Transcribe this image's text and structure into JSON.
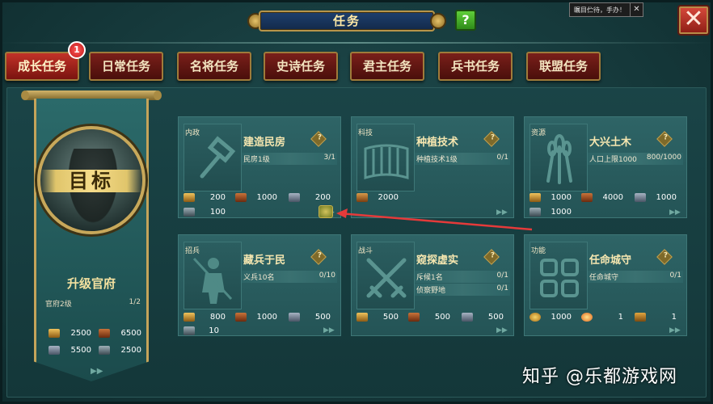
{
  "title": "任务",
  "help_label": "?",
  "tooltip": {
    "text": "瞩目伫待，手办！",
    "close": "✕"
  },
  "close_label": "✕",
  "tabs": [
    {
      "label": "成长任务",
      "active": true,
      "badge": "1"
    },
    {
      "label": "日常任务"
    },
    {
      "label": "名将任务"
    },
    {
      "label": "史诗任务"
    },
    {
      "label": "君主任务"
    },
    {
      "label": "兵书任务"
    },
    {
      "label": "联盟任务"
    }
  ],
  "banner": {
    "target": "目标",
    "title": "升级官府",
    "requirement": "官府2级",
    "progress": "1/2",
    "costs": [
      {
        "icon": "copper-icon",
        "value": "2500"
      },
      {
        "icon": "wood-icon",
        "value": "6500"
      },
      {
        "icon": "iron-icon",
        "value": "5500"
      },
      {
        "icon": "troop-icon",
        "value": "2500"
      }
    ],
    "arrow": "▶▶"
  },
  "cards": [
    {
      "type": "内政",
      "name": "建造民房",
      "icon": "hammer-icon",
      "qmark": "?",
      "reqs": [
        {
          "text": "民房1级",
          "progress": "3/1"
        }
      ],
      "costs": [
        {
          "icon": "copper-icon",
          "value": "200"
        },
        {
          "icon": "wood-icon",
          "value": "1000"
        },
        {
          "icon": "iron-icon",
          "value": "200"
        },
        {
          "icon": "troop-icon",
          "value": "100"
        }
      ],
      "arrow": "▶▶"
    },
    {
      "type": "科技",
      "name": "种植技术",
      "icon": "scroll-icon",
      "qmark": "?",
      "reqs": [
        {
          "text": "种植技术1级",
          "progress": "0/1"
        }
      ],
      "costs": [
        {
          "icon": "food-icon",
          "value": "2000"
        }
      ],
      "arrow": "▶▶"
    },
    {
      "type": "资源",
      "name": "大兴土木",
      "icon": "wheat-icon",
      "qmark": "?",
      "reqs": [
        {
          "text": "人口上限1000",
          "progress": "800/1000"
        }
      ],
      "costs": [
        {
          "icon": "copper-icon",
          "value": "1000"
        },
        {
          "icon": "wood-icon",
          "value": "4000"
        },
        {
          "icon": "iron-icon",
          "value": "1000"
        },
        {
          "icon": "troop-icon",
          "value": "1000"
        }
      ],
      "arrow": "▶▶"
    },
    {
      "type": "招兵",
      "name": "藏兵于民",
      "icon": "soldier-icon",
      "qmark": "?",
      "reqs": [
        {
          "text": "义兵10名",
          "progress": "0/10"
        }
      ],
      "costs": [
        {
          "icon": "copper-icon",
          "value": "800"
        },
        {
          "icon": "wood-icon",
          "value": "1000"
        },
        {
          "icon": "iron-icon",
          "value": "500"
        },
        {
          "icon": "troop-icon",
          "value": "10"
        }
      ],
      "arrow": "▶▶"
    },
    {
      "type": "战斗",
      "name": "窥探虚实",
      "icon": "crossed-swords-icon",
      "qmark": "?",
      "reqs": [
        {
          "text": "斥候1名",
          "progress": "0/1"
        },
        {
          "text": "侦察野地",
          "progress": "0/1"
        }
      ],
      "costs": [
        {
          "icon": "copper-icon",
          "value": "500"
        },
        {
          "icon": "wood-icon",
          "value": "500"
        },
        {
          "icon": "iron-icon",
          "value": "500"
        }
      ],
      "arrow": "▶▶"
    },
    {
      "type": "功能",
      "name": "任命城守",
      "icon": "grid-icon",
      "qmark": "?",
      "reqs": [
        {
          "text": "任命城守",
          "progress": "0/1"
        }
      ],
      "costs": [
        {
          "icon": "gold-icon",
          "value": "1000"
        },
        {
          "icon": "fire-icon",
          "value": "1"
        },
        {
          "icon": "scroll-icon",
          "value": "1"
        }
      ],
      "arrow": "▶▶"
    }
  ],
  "watermark": "知乎 @乐都游戏网"
}
